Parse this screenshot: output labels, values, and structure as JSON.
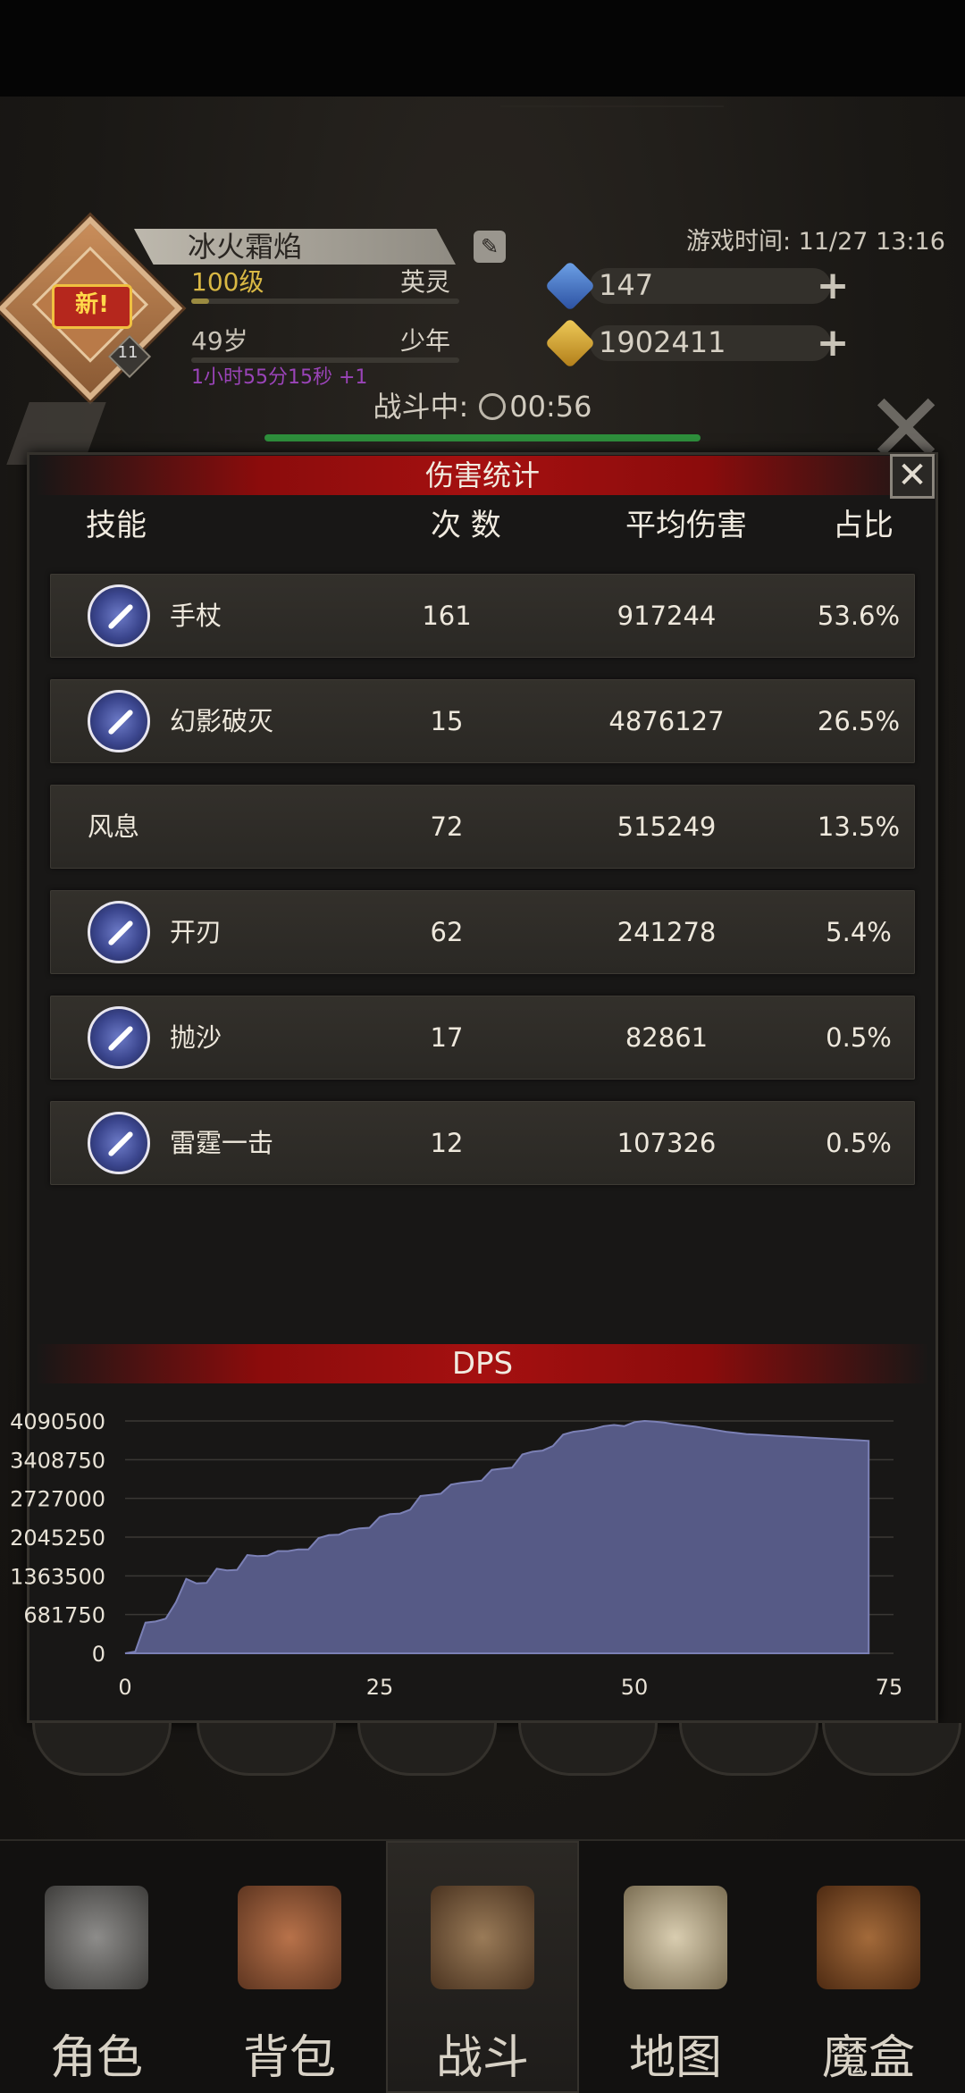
{
  "header": {
    "new_badge": "新!",
    "avatar_level": "11",
    "name": "冰火霜焰",
    "level": "100级",
    "rank": "英灵",
    "age": "49岁",
    "age_stage": "少年",
    "time_bonus": "1小时55分15秒 +1",
    "game_time": "游戏时间: 11/27 13:16",
    "gems": "147",
    "gold": "1902411",
    "battle_label": "战斗中:",
    "battle_timer": "00:56"
  },
  "panel": {
    "title": "伤害统计",
    "close": "✕",
    "columns": {
      "skill": "技能",
      "count": "次 数",
      "avg": "平均伤害",
      "ratio": "占比"
    },
    "rows": [
      {
        "name": "手杖",
        "count": "161",
        "avg": "917244",
        "ratio": "53.6%",
        "icon": "staff-icon"
      },
      {
        "name": "幻影破灭",
        "count": "15",
        "avg": "4876127",
        "ratio": "26.5%",
        "icon": "phantom-icon"
      },
      {
        "name": "风息",
        "count": "72",
        "avg": "515249",
        "ratio": "13.5%",
        "icon": ""
      },
      {
        "name": "开刃",
        "count": "62",
        "avg": "241278",
        "ratio": "5.4%",
        "icon": "blade-icon"
      },
      {
        "name": "抛沙",
        "count": "17",
        "avg": "82861",
        "ratio": "0.5%",
        "icon": "sand-icon"
      },
      {
        "name": "雷霆一击",
        "count": "12",
        "avg": "107326",
        "ratio": "0.5%",
        "icon": "thunder-icon"
      }
    ]
  },
  "chart_data": {
    "type": "area",
    "title": "DPS",
    "xlabel": "",
    "ylabel": "",
    "xlim": [
      0,
      75
    ],
    "ylim": [
      0,
      4090500
    ],
    "xticks": [
      "0",
      "25",
      "50",
      "75"
    ],
    "yticks": [
      "0",
      "681750",
      "1363500",
      "2045250",
      "2727000",
      "3408750",
      "4090500"
    ],
    "grid": true,
    "color": "#565a86",
    "x": [
      0,
      1,
      2,
      3,
      4,
      5,
      6,
      7,
      8,
      9,
      10,
      11,
      12,
      13,
      14,
      15,
      16,
      17,
      18,
      19,
      20,
      21,
      22,
      23,
      24,
      25,
      26,
      27,
      28,
      29,
      30,
      31,
      32,
      33,
      34,
      35,
      36,
      37,
      38,
      39,
      40,
      41,
      42,
      43,
      44,
      45,
      46,
      47,
      48,
      49,
      50,
      51,
      52,
      53,
      54,
      55,
      56,
      57,
      58,
      59,
      60,
      61,
      62,
      63,
      64,
      65,
      66,
      67,
      68,
      69,
      70,
      71,
      72,
      73
    ],
    "y": [
      0,
      30000,
      540000,
      560000,
      610000,
      900000,
      1310000,
      1230000,
      1240000,
      1490000,
      1460000,
      1470000,
      1730000,
      1710000,
      1720000,
      1800000,
      1800000,
      1830000,
      1830000,
      2030000,
      2080000,
      2090000,
      2170000,
      2200000,
      2210000,
      2400000,
      2450000,
      2460000,
      2530000,
      2770000,
      2790000,
      2810000,
      2970000,
      3000000,
      3020000,
      3040000,
      3230000,
      3250000,
      3270000,
      3500000,
      3550000,
      3570000,
      3650000,
      3850000,
      3900000,
      3920000,
      3950000,
      4000000,
      4020000,
      4000000,
      4070000,
      4090500,
      4080000,
      4060000,
      4030000,
      4010000,
      3990000,
      3960000,
      3930000,
      3900000,
      3880000,
      3860000,
      3850000,
      3840000,
      3830000,
      3820000,
      3810000,
      3800000,
      3790000,
      3780000,
      3770000,
      3760000,
      3750000,
      3740000
    ]
  },
  "nav": {
    "items": [
      {
        "label": "角色",
        "icon": "helmet-icon"
      },
      {
        "label": "背包",
        "icon": "backpack-icon"
      },
      {
        "label": "战斗",
        "icon": "shield-sword-icon"
      },
      {
        "label": "地图",
        "icon": "scroll-map-icon"
      },
      {
        "label": "魔盒",
        "icon": "magic-box-icon"
      }
    ],
    "active_index": 2
  }
}
